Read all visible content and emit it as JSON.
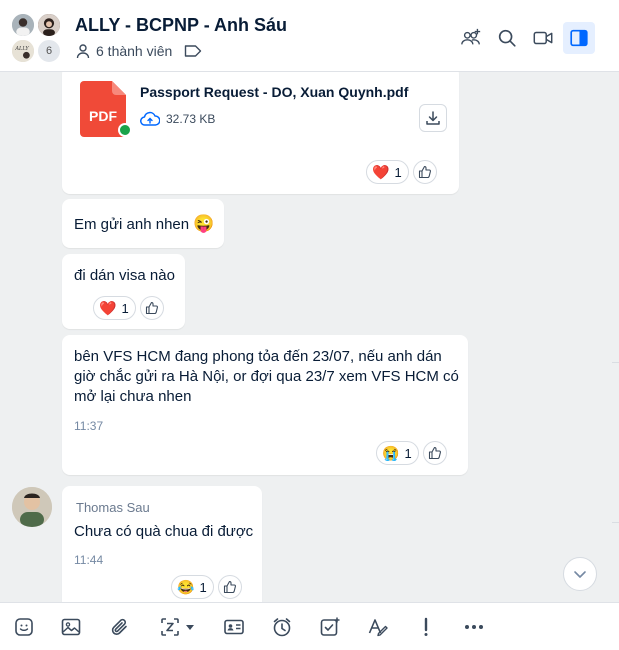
{
  "header": {
    "title": "ALLY - BCPNP - Anh Sáu",
    "member_count": "6",
    "members_label": "6 thành viên",
    "avatar_logo_text": "ALLY"
  },
  "messages": [
    {
      "type": "file",
      "file_name": "Passport Request - DO, Xuan Quynh.pdf",
      "file_badge": "PDF",
      "file_size": "32.73 KB",
      "reaction_emoji": "❤️",
      "reaction_count": "1"
    },
    {
      "type": "text",
      "text": "Em gửi anh nhen",
      "emoji": "😜"
    },
    {
      "type": "text",
      "text": "đi dán visa nào",
      "reaction_emoji": "❤️",
      "reaction_count": "1"
    },
    {
      "type": "text",
      "lines": [
        "bên VFS HCM đang phong tỏa đến 23/07, nếu anh dán",
        "giờ chắc gửi ra Hà Nội, or đợi qua 23/7 xem VFS HCM có",
        "mở lại chưa nhen"
      ],
      "time": "11:37",
      "reaction_emoji": "😭",
      "reaction_count": "1"
    },
    {
      "type": "text",
      "sender": "Thomas Sau",
      "text": "Chưa có quà chua đi được",
      "time": "11:44",
      "reaction_emoji": "😂",
      "reaction_count": "1"
    }
  ],
  "colors": {
    "accent": "#0068ff",
    "chat_background": "#eef0f1",
    "pdf_red": "#f04a38",
    "online_green": "#1aa34a"
  },
  "icons": {
    "header": [
      "add-member-icon",
      "search-icon",
      "video-call-icon",
      "sidebar-toggle-icon"
    ],
    "toolbar": [
      "sticker-icon",
      "image-icon",
      "attachment-icon",
      "screenshot-icon",
      "business-card-icon",
      "reminder-icon",
      "task-icon",
      "text-format-icon",
      "urgent-icon",
      "more-icon"
    ]
  }
}
